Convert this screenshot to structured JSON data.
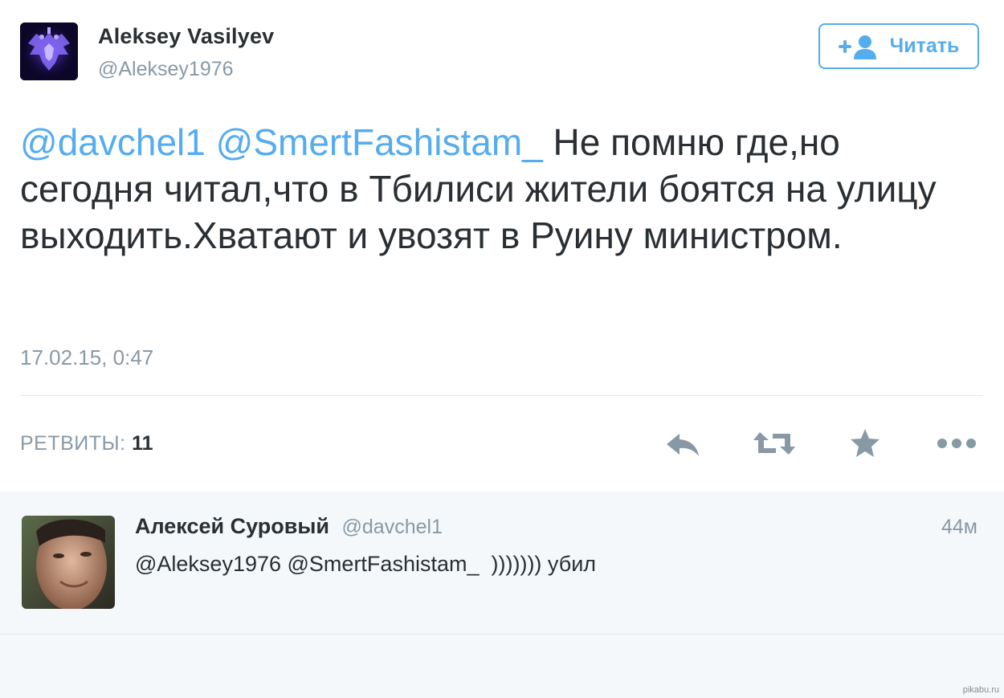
{
  "author": {
    "name": "Aleksey Vasilyev",
    "handle": "@Aleksey1976",
    "avatar_icon": "coat-of-arms-icon"
  },
  "follow_button": {
    "label": "Читать",
    "icon": "add-user-icon"
  },
  "tweet": {
    "mention_1": "@davchel1",
    "mention_2": "@SmertFashistam_",
    "text": "Не помню где,но сегодня читал,что в Тбилиси жители боятся на улицу выходить.Хватают и увозят в Руину министром.",
    "timestamp": "17.02.15, 0:47"
  },
  "stats": {
    "retweets_label": "РЕТВИТЫ:",
    "retweets_count": "11"
  },
  "actions": [
    "reply-icon",
    "retweet-icon",
    "favorite-icon",
    "more-icon"
  ],
  "reply": {
    "name": "Алексей Суровый",
    "handle": "@davchel1",
    "time": "44м",
    "text": "@Aleksey1976 @SmertFashistam_  ))))))) убил"
  },
  "watermark": "pikabu.ru",
  "colors": {
    "accent": "#55acee",
    "text": "#292f33",
    "muted": "#8899a6",
    "background": "#f5f8fa"
  }
}
